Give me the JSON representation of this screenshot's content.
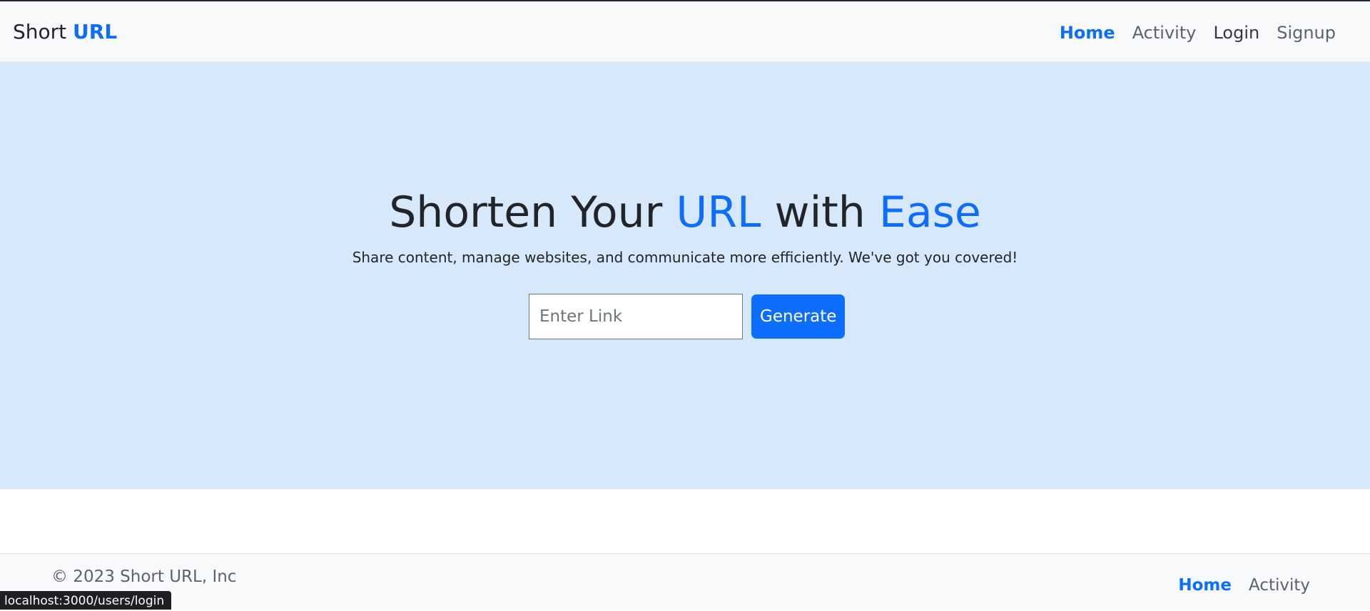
{
  "navbar": {
    "brand_prefix": "Short",
    "brand_accent": "URL",
    "links": [
      {
        "label": "Home"
      },
      {
        "label": "Activity"
      },
      {
        "label": "Login"
      },
      {
        "label": "Signup"
      }
    ]
  },
  "hero": {
    "title_part1": "Shorten Your ",
    "title_part2": "URL",
    "title_part3": " with ",
    "title_part4": "Ease",
    "subtitle": "Share content, manage websites, and communicate more efficiently. We've got you covered!",
    "input_placeholder": "Enter Link",
    "input_value": "",
    "generate_label": "Generate"
  },
  "footer": {
    "copyright": "© 2023 Short URL, Inc",
    "links": [
      {
        "label": "Home"
      },
      {
        "label": "Activity"
      }
    ]
  },
  "status_bar": {
    "url": "localhost:3000/users/login"
  },
  "colors": {
    "accent": "#0d6efd",
    "hero_bg": "#d6e8f9",
    "navbar_bg": "#f8f9fa"
  }
}
